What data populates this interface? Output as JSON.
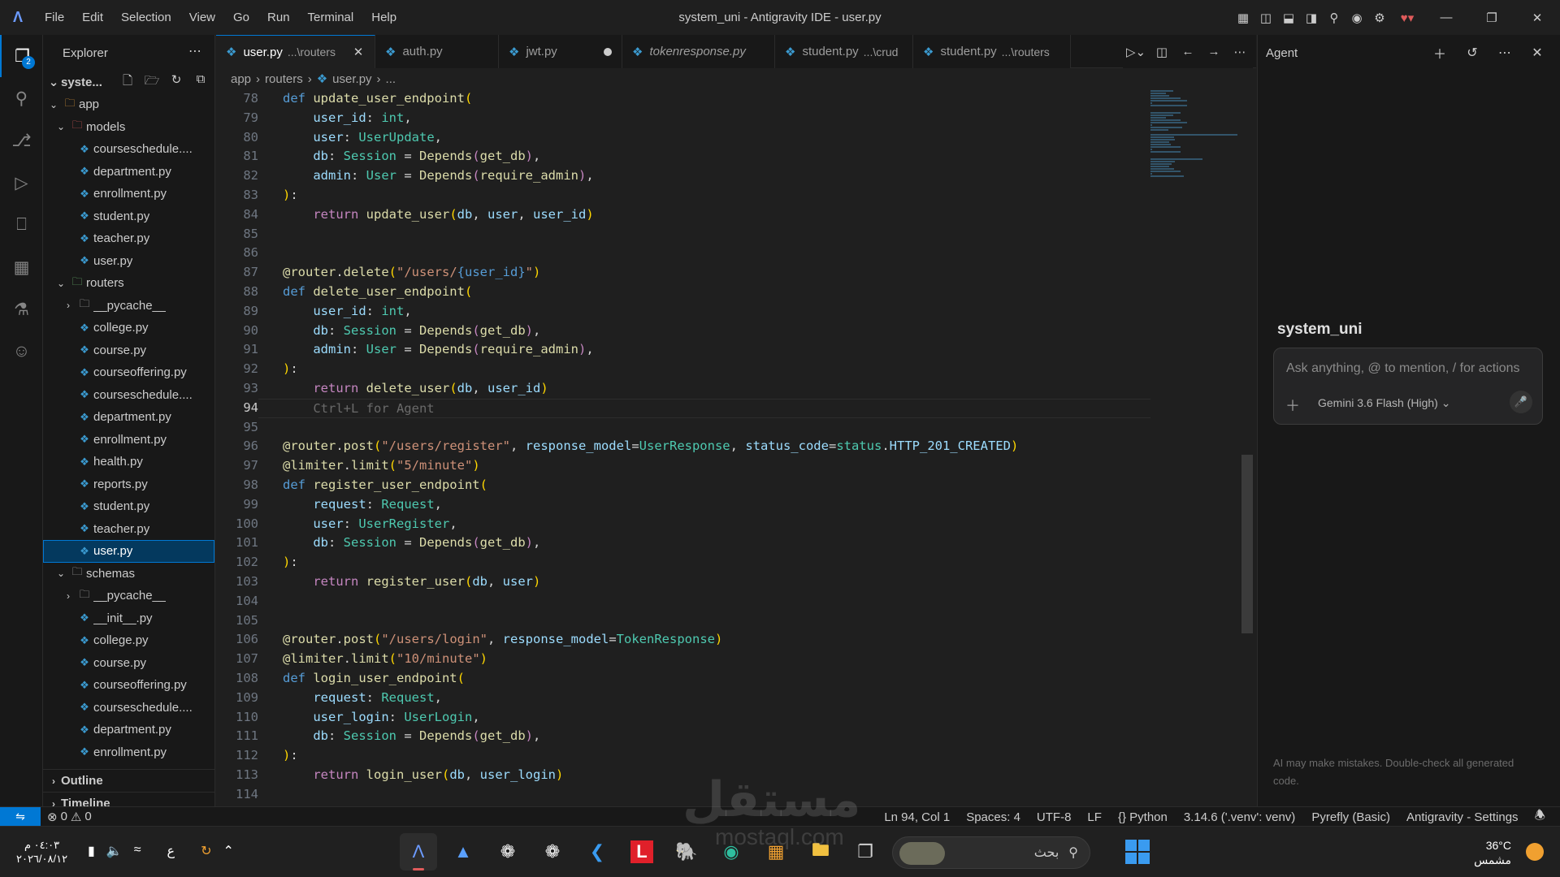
{
  "titlebar": {
    "menu": [
      "File",
      "Edit",
      "Selection",
      "View",
      "Go",
      "Run",
      "Terminal",
      "Help"
    ],
    "window_title": "system_uni - Antigravity IDE - user.py"
  },
  "activity": {
    "explorer_badge": "2"
  },
  "sidebar": {
    "title": "Explorer",
    "root": "syste...",
    "tree": [
      {
        "depth": 1,
        "kind": "folder",
        "open": true,
        "label": "app",
        "style": "app"
      },
      {
        "depth": 2,
        "kind": "folder",
        "open": true,
        "label": "models",
        "style": "models"
      },
      {
        "depth": 3,
        "kind": "file",
        "label": "courseschedule...."
      },
      {
        "depth": 3,
        "kind": "file",
        "label": "department.py"
      },
      {
        "depth": 3,
        "kind": "file",
        "label": "enrollment.py"
      },
      {
        "depth": 3,
        "kind": "file",
        "label": "student.py"
      },
      {
        "depth": 3,
        "kind": "file",
        "label": "teacher.py"
      },
      {
        "depth": 3,
        "kind": "file",
        "label": "user.py"
      },
      {
        "depth": 2,
        "kind": "folder",
        "open": true,
        "label": "routers",
        "style": "routers"
      },
      {
        "depth": 3,
        "kind": "folder",
        "open": false,
        "label": "__pycache__",
        "style": ""
      },
      {
        "depth": 3,
        "kind": "file",
        "label": "college.py"
      },
      {
        "depth": 3,
        "kind": "file",
        "label": "course.py"
      },
      {
        "depth": 3,
        "kind": "file",
        "label": "courseoffering.py"
      },
      {
        "depth": 3,
        "kind": "file",
        "label": "courseschedule...."
      },
      {
        "depth": 3,
        "kind": "file",
        "label": "department.py"
      },
      {
        "depth": 3,
        "kind": "file",
        "label": "enrollment.py"
      },
      {
        "depth": 3,
        "kind": "file",
        "label": "health.py"
      },
      {
        "depth": 3,
        "kind": "file",
        "label": "reports.py"
      },
      {
        "depth": 3,
        "kind": "file",
        "label": "student.py"
      },
      {
        "depth": 3,
        "kind": "file",
        "label": "teacher.py"
      },
      {
        "depth": 3,
        "kind": "file",
        "label": "user.py",
        "selected": true
      },
      {
        "depth": 2,
        "kind": "folder",
        "open": true,
        "label": "schemas",
        "style": ""
      },
      {
        "depth": 3,
        "kind": "folder",
        "open": false,
        "label": "__pycache__",
        "style": ""
      },
      {
        "depth": 3,
        "kind": "file",
        "label": "__init__.py"
      },
      {
        "depth": 3,
        "kind": "file",
        "label": "college.py"
      },
      {
        "depth": 3,
        "kind": "file",
        "label": "course.py"
      },
      {
        "depth": 3,
        "kind": "file",
        "label": "courseoffering.py"
      },
      {
        "depth": 3,
        "kind": "file",
        "label": "courseschedule...."
      },
      {
        "depth": 3,
        "kind": "file",
        "label": "department.py"
      },
      {
        "depth": 3,
        "kind": "file",
        "label": "enrollment.py"
      }
    ],
    "outline": "Outline",
    "timeline": "Timeline"
  },
  "tabs": [
    {
      "label": "user.py",
      "desc": "...\\routers",
      "active": true,
      "italic": false,
      "state": "close"
    },
    {
      "label": "auth.py",
      "desc": "",
      "active": false,
      "italic": false,
      "state": ""
    },
    {
      "label": "jwt.py",
      "desc": "",
      "active": false,
      "italic": false,
      "state": "dirty"
    },
    {
      "label": "tokenresponse.py",
      "desc": "",
      "active": false,
      "italic": true,
      "state": ""
    },
    {
      "label": "student.py",
      "desc": "...\\crud",
      "active": false,
      "italic": false,
      "state": ""
    },
    {
      "label": "student.py",
      "desc": "...\\routers",
      "active": false,
      "italic": false,
      "state": ""
    }
  ],
  "breadcrumb": [
    "app",
    "routers",
    "user.py",
    "..."
  ],
  "code": {
    "current_line": 94,
    "lines": [
      {
        "n": 78,
        "t": [
          [
            "kw",
            "def "
          ],
          [
            "fn",
            "update_user_endpoint"
          ],
          [
            "br",
            "("
          ]
        ]
      },
      {
        "n": 79,
        "t": [
          [
            "pu",
            "    "
          ],
          [
            "va",
            "user_id"
          ],
          [
            "pu",
            ": "
          ],
          [
            "ty",
            "int"
          ],
          [
            "pu",
            ","
          ]
        ]
      },
      {
        "n": 80,
        "t": [
          [
            "pu",
            "    "
          ],
          [
            "va",
            "user"
          ],
          [
            "pu",
            ": "
          ],
          [
            "ty",
            "UserUpdate"
          ],
          [
            "pu",
            ","
          ]
        ]
      },
      {
        "n": 81,
        "t": [
          [
            "pu",
            "    "
          ],
          [
            "va",
            "db"
          ],
          [
            "pu",
            ": "
          ],
          [
            "ty",
            "Session"
          ],
          [
            "pu",
            " = "
          ],
          [
            "fn",
            "Depends"
          ],
          [
            "ctl",
            "("
          ],
          [
            "fn",
            "get_db"
          ],
          [
            "ctl",
            ")"
          ],
          [
            "pu",
            ","
          ]
        ]
      },
      {
        "n": 82,
        "t": [
          [
            "pu",
            "    "
          ],
          [
            "va",
            "admin"
          ],
          [
            "pu",
            ": "
          ],
          [
            "ty",
            "User"
          ],
          [
            "pu",
            " = "
          ],
          [
            "fn",
            "Depends"
          ],
          [
            "ctl",
            "("
          ],
          [
            "fn",
            "require_admin"
          ],
          [
            "ctl",
            ")"
          ],
          [
            "pu",
            ","
          ]
        ]
      },
      {
        "n": 83,
        "t": [
          [
            "br",
            ")"
          ],
          [
            "pu",
            ":"
          ]
        ]
      },
      {
        "n": 84,
        "t": [
          [
            "pu",
            "    "
          ],
          [
            "ctl",
            "return "
          ],
          [
            "fn",
            "update_user"
          ],
          [
            "br",
            "("
          ],
          [
            "va",
            "db"
          ],
          [
            "pu",
            ", "
          ],
          [
            "va",
            "user"
          ],
          [
            "pu",
            ", "
          ],
          [
            "va",
            "user_id"
          ],
          [
            "br",
            ")"
          ]
        ]
      },
      {
        "n": 85,
        "t": []
      },
      {
        "n": 86,
        "t": []
      },
      {
        "n": 87,
        "t": [
          [
            "fn",
            "@router"
          ],
          [
            "pu",
            "."
          ],
          [
            "fn",
            "delete"
          ],
          [
            "br",
            "("
          ],
          [
            "st",
            "\"/users/"
          ],
          [
            "intp",
            "{user_id}"
          ],
          [
            "st",
            "\""
          ],
          [
            "br",
            ")"
          ]
        ]
      },
      {
        "n": 88,
        "t": [
          [
            "kw",
            "def "
          ],
          [
            "fn",
            "delete_user_endpoint"
          ],
          [
            "br",
            "("
          ]
        ]
      },
      {
        "n": 89,
        "t": [
          [
            "pu",
            "    "
          ],
          [
            "va",
            "user_id"
          ],
          [
            "pu",
            ": "
          ],
          [
            "ty",
            "int"
          ],
          [
            "pu",
            ","
          ]
        ]
      },
      {
        "n": 90,
        "t": [
          [
            "pu",
            "    "
          ],
          [
            "va",
            "db"
          ],
          [
            "pu",
            ": "
          ],
          [
            "ty",
            "Session"
          ],
          [
            "pu",
            " = "
          ],
          [
            "fn",
            "Depends"
          ],
          [
            "ctl",
            "("
          ],
          [
            "fn",
            "get_db"
          ],
          [
            "ctl",
            ")"
          ],
          [
            "pu",
            ","
          ]
        ]
      },
      {
        "n": 91,
        "t": [
          [
            "pu",
            "    "
          ],
          [
            "va",
            "admin"
          ],
          [
            "pu",
            ": "
          ],
          [
            "ty",
            "User"
          ],
          [
            "pu",
            " = "
          ],
          [
            "fn",
            "Depends"
          ],
          [
            "ctl",
            "("
          ],
          [
            "fn",
            "require_admin"
          ],
          [
            "ctl",
            ")"
          ],
          [
            "pu",
            ","
          ]
        ]
      },
      {
        "n": 92,
        "t": [
          [
            "br",
            ")"
          ],
          [
            "pu",
            ":"
          ]
        ]
      },
      {
        "n": 93,
        "t": [
          [
            "pu",
            "    "
          ],
          [
            "ctl",
            "return "
          ],
          [
            "fn",
            "delete_user"
          ],
          [
            "br",
            "("
          ],
          [
            "va",
            "db"
          ],
          [
            "pu",
            ", "
          ],
          [
            "va",
            "user_id"
          ],
          [
            "br",
            ")"
          ]
        ]
      },
      {
        "n": 94,
        "t": [
          [
            "pu",
            "    "
          ],
          [
            "ghost",
            "Ctrl+L for Agent"
          ]
        ]
      },
      {
        "n": 95,
        "t": []
      },
      {
        "n": 96,
        "t": [
          [
            "fn",
            "@router"
          ],
          [
            "pu",
            "."
          ],
          [
            "fn",
            "post"
          ],
          [
            "br",
            "("
          ],
          [
            "st",
            "\"/users/register\""
          ],
          [
            "pu",
            ", "
          ],
          [
            "va",
            "response_model"
          ],
          [
            "pu",
            "="
          ],
          [
            "ty",
            "UserResponse"
          ],
          [
            "pu",
            ", "
          ],
          [
            "va",
            "status_code"
          ],
          [
            "pu",
            "="
          ],
          [
            "ty",
            "status"
          ],
          [
            "pu",
            "."
          ],
          [
            "va",
            "HTTP_201_CREATED"
          ],
          [
            "br",
            ")"
          ]
        ]
      },
      {
        "n": 97,
        "t": [
          [
            "fn",
            "@limiter"
          ],
          [
            "pu",
            "."
          ],
          [
            "fn",
            "limit"
          ],
          [
            "br",
            "("
          ],
          [
            "st",
            "\"5/minute\""
          ],
          [
            "br",
            ")"
          ]
        ]
      },
      {
        "n": 98,
        "t": [
          [
            "kw",
            "def "
          ],
          [
            "fn",
            "register_user_endpoint"
          ],
          [
            "br",
            "("
          ]
        ]
      },
      {
        "n": 99,
        "t": [
          [
            "pu",
            "    "
          ],
          [
            "va",
            "request"
          ],
          [
            "pu",
            ": "
          ],
          [
            "ty",
            "Request"
          ],
          [
            "pu",
            ","
          ]
        ]
      },
      {
        "n": 100,
        "t": [
          [
            "pu",
            "    "
          ],
          [
            "va",
            "user"
          ],
          [
            "pu",
            ": "
          ],
          [
            "ty",
            "UserRegister"
          ],
          [
            "pu",
            ","
          ]
        ]
      },
      {
        "n": 101,
        "t": [
          [
            "pu",
            "    "
          ],
          [
            "va",
            "db"
          ],
          [
            "pu",
            ": "
          ],
          [
            "ty",
            "Session"
          ],
          [
            "pu",
            " = "
          ],
          [
            "fn",
            "Depends"
          ],
          [
            "ctl",
            "("
          ],
          [
            "fn",
            "get_db"
          ],
          [
            "ctl",
            ")"
          ],
          [
            "pu",
            ","
          ]
        ]
      },
      {
        "n": 102,
        "t": [
          [
            "br",
            ")"
          ],
          [
            "pu",
            ":"
          ]
        ]
      },
      {
        "n": 103,
        "t": [
          [
            "pu",
            "    "
          ],
          [
            "ctl",
            "return "
          ],
          [
            "fn",
            "register_user"
          ],
          [
            "br",
            "("
          ],
          [
            "va",
            "db"
          ],
          [
            "pu",
            ", "
          ],
          [
            "va",
            "user"
          ],
          [
            "br",
            ")"
          ]
        ]
      },
      {
        "n": 104,
        "t": []
      },
      {
        "n": 105,
        "t": []
      },
      {
        "n": 106,
        "t": [
          [
            "fn",
            "@router"
          ],
          [
            "pu",
            "."
          ],
          [
            "fn",
            "post"
          ],
          [
            "br",
            "("
          ],
          [
            "st",
            "\"/users/login\""
          ],
          [
            "pu",
            ", "
          ],
          [
            "va",
            "response_model"
          ],
          [
            "pu",
            "="
          ],
          [
            "ty",
            "TokenResponse"
          ],
          [
            "br",
            ")"
          ]
        ]
      },
      {
        "n": 107,
        "t": [
          [
            "fn",
            "@limiter"
          ],
          [
            "pu",
            "."
          ],
          [
            "fn",
            "limit"
          ],
          [
            "br",
            "("
          ],
          [
            "st",
            "\"10/minute\""
          ],
          [
            "br",
            ")"
          ]
        ]
      },
      {
        "n": 108,
        "t": [
          [
            "kw",
            "def "
          ],
          [
            "fn",
            "login_user_endpoint"
          ],
          [
            "br",
            "("
          ]
        ]
      },
      {
        "n": 109,
        "t": [
          [
            "pu",
            "    "
          ],
          [
            "va",
            "request"
          ],
          [
            "pu",
            ": "
          ],
          [
            "ty",
            "Request"
          ],
          [
            "pu",
            ","
          ]
        ]
      },
      {
        "n": 110,
        "t": [
          [
            "pu",
            "    "
          ],
          [
            "va",
            "user_login"
          ],
          [
            "pu",
            ": "
          ],
          [
            "ty",
            "UserLogin"
          ],
          [
            "pu",
            ","
          ]
        ]
      },
      {
        "n": 111,
        "t": [
          [
            "pu",
            "    "
          ],
          [
            "va",
            "db"
          ],
          [
            "pu",
            ": "
          ],
          [
            "ty",
            "Session"
          ],
          [
            "pu",
            " = "
          ],
          [
            "fn",
            "Depends"
          ],
          [
            "ctl",
            "("
          ],
          [
            "fn",
            "get_db"
          ],
          [
            "ctl",
            ")"
          ],
          [
            "pu",
            ","
          ]
        ]
      },
      {
        "n": 112,
        "t": [
          [
            "br",
            ")"
          ],
          [
            "pu",
            ":"
          ]
        ]
      },
      {
        "n": 113,
        "t": [
          [
            "pu",
            "    "
          ],
          [
            "ctl",
            "return "
          ],
          [
            "fn",
            "login_user"
          ],
          [
            "br",
            "("
          ],
          [
            "va",
            "db"
          ],
          [
            "pu",
            ", "
          ],
          [
            "va",
            "user_login"
          ],
          [
            "br",
            ")"
          ]
        ]
      },
      {
        "n": 114,
        "t": []
      }
    ]
  },
  "agent": {
    "title": "Agent",
    "project": "system_uni",
    "input_placeholder": "Ask anything, @ to mention, / for actions",
    "model": "Gemini 3.6 Flash (High)",
    "disclaimer": "AI may make mistakes. Double-check all generated code."
  },
  "statusbar": {
    "errors": "0",
    "warnings": "0",
    "cursor": "Ln 94, Col 1",
    "spaces": "Spaces: 4",
    "encoding": "UTF-8",
    "eol": "LF",
    "language": "Python",
    "interpreter": "3.14.6 ('.venv': venv)",
    "pyrefly": "Pyrefly (Basic)",
    "settings": "Antigravity - Settings"
  },
  "taskbar": {
    "time": "٠٤:٠٣ م",
    "date": "٢٠٢٦/٠٨/١٢",
    "lang": "ع",
    "search_label": "بحث",
    "temperature": "36°C",
    "weather_desc": "مشمس"
  },
  "watermark": {
    "main": "مستقل",
    "sub": "mostaql.com"
  },
  "colors": {
    "accent": "#0078d4",
    "background": "#1f1f1f",
    "sidebar": "#181818"
  }
}
